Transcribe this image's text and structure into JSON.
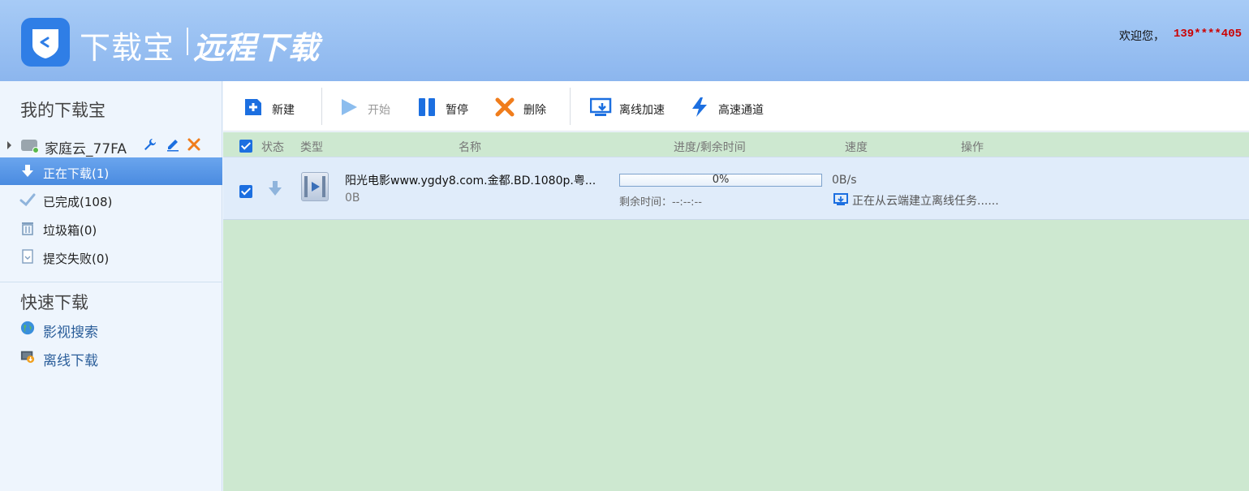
{
  "header": {
    "brand": "下载宝",
    "brand_sub": "远程下载",
    "welcome": "欢迎您，",
    "user": "139****405"
  },
  "sidebar": {
    "title": "我的下载宝",
    "device_name": "家庭云_77FA",
    "items": [
      {
        "label": "正在下载(1)",
        "icon": "download-arrow-icon",
        "active": true
      },
      {
        "label": "已完成(108)",
        "icon": "check-icon",
        "active": false
      },
      {
        "label": "垃圾箱(0)",
        "icon": "trash-icon",
        "active": false
      },
      {
        "label": "提交失败(0)",
        "icon": "failed-doc-icon",
        "active": false
      }
    ],
    "quick_title": "快速下载",
    "quick_items": [
      {
        "label": "影视搜索",
        "icon": "globe-icon"
      },
      {
        "label": "离线下载",
        "icon": "offline-download-icon"
      }
    ]
  },
  "toolbar": {
    "new": "新建",
    "start": "开始",
    "pause": "暂停",
    "delete": "删除",
    "offline": "离线加速",
    "highspeed": "高速通道"
  },
  "columns": {
    "status": "状态",
    "type": "类型",
    "name": "名称",
    "progress": "进度/剩余时间",
    "speed": "速度",
    "action": "操作"
  },
  "tasks": [
    {
      "name": "阳光电影www.ygdy8.com.金都.BD.1080p.粤...",
      "size": "0B",
      "progress_value": 0,
      "progress_text": "0%",
      "remaining": "剩余时间：--:--:--",
      "speed": "0B/s",
      "status": "正在从云端建立离线任务......"
    }
  ],
  "colors": {
    "header_top": "#a7cbf6",
    "accent": "#1c6fe0",
    "content_bg": "#cde8d0",
    "user_red": "#cc0000"
  }
}
